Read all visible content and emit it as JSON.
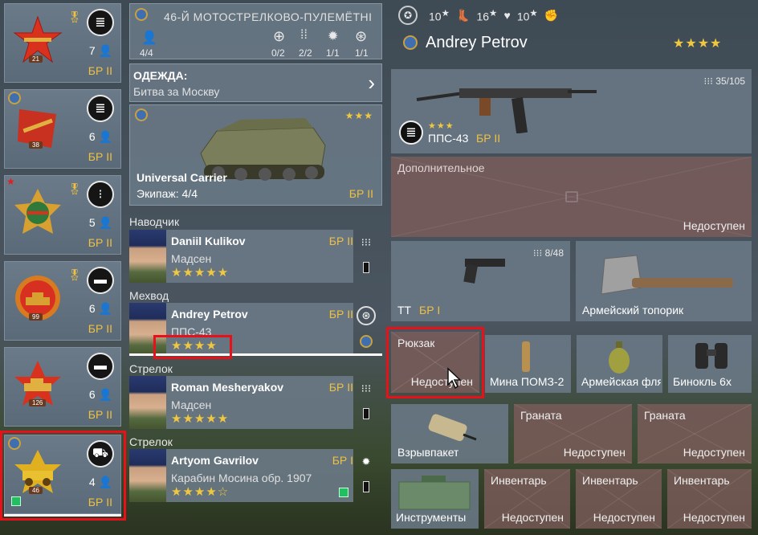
{
  "squads": [
    {
      "count": "7",
      "br": "БР II",
      "lvl": "21",
      "type_icon": "document-icon",
      "emblem": "rifle-star-emblem",
      "medal": "gold"
    },
    {
      "count": "6",
      "br": "БР II",
      "lvl": "38",
      "type_icon": "document-icon",
      "emblem": "rifle-emblem",
      "medal": "blue"
    },
    {
      "count": "5",
      "br": "БР II",
      "lvl": "",
      "type_icon": "ammo-icon",
      "emblem": "engineer-emblem",
      "medal": "gold"
    },
    {
      "count": "6",
      "br": "БР II",
      "lvl": "99",
      "type_icon": "tank-icon",
      "emblem": "tank-emblem",
      "medal": "gold"
    },
    {
      "count": "6",
      "br": "БР II",
      "lvl": "126",
      "type_icon": "tank-icon",
      "emblem": "tank-star-emblem",
      "medal": ""
    },
    {
      "count": "4",
      "br": "БР II",
      "lvl": "46",
      "type_icon": "car-icon",
      "emblem": "vehicle-emblem",
      "medal": "blue"
    }
  ],
  "squad_header": {
    "title": "46-Й МОТОСТРЕЛКОВО-ПУЛЕМЁТНІ",
    "soldiers": "4/4",
    "slots": [
      "0/2",
      "2/2",
      "1/1",
      "1/1"
    ]
  },
  "outfit": {
    "label": "ОДЕЖДА:",
    "value": "Битва за Москву"
  },
  "vehicle": {
    "name": "Universal Carrier",
    "crew": "Экипаж: 4/4",
    "br": "БР II",
    "stars": "★★★"
  },
  "roles": [
    "Наводчик",
    "Мехвод",
    "Стрелок",
    "Стрелок"
  ],
  "soldiers": [
    {
      "name": "Daniil Kulikov",
      "weapon": "Мадсен",
      "stars": "★★★★★",
      "br": "БР II"
    },
    {
      "name": "Andrey Petrov",
      "weapon": "ППС-43",
      "stars": "★★★★",
      "br": "БР II"
    },
    {
      "name": "Roman Mesheryakov",
      "weapon": "Мадсен",
      "stars": "★★★★★",
      "br": "БР II"
    },
    {
      "name": "Artyom Gavrilov",
      "weapon": "Карабин Мосина обр. 1907",
      "stars": "★★★★☆",
      "br": "БР I"
    }
  ],
  "stats": [
    {
      "value": "10",
      "star": "★"
    },
    {
      "value": "16",
      "star": "★"
    },
    {
      "value": "10",
      "star": "★"
    }
  ],
  "selected_soldier": {
    "name": "Andrey Petrov",
    "stars": "★★★★"
  },
  "primary_weapon": {
    "name": "ППС-43",
    "br": "БР II",
    "ammo": "35/105",
    "stars": "★★★"
  },
  "secondary": {
    "label": "Дополнительное",
    "status": "Недоступен"
  },
  "pistol": {
    "name": "ТТ",
    "br": "БР I",
    "ammo": "8/48"
  },
  "melee": {
    "name": "Армейский топорик"
  },
  "backpack": {
    "label": "Рюкзак",
    "status": "Недоступен"
  },
  "items": [
    "Мина ПОМЗ-2",
    "Армейская фляга",
    "Бинокль 6х"
  ],
  "grenades": [
    {
      "name": "Взрывпакет"
    },
    {
      "label": "Граната",
      "status": "Недоступен"
    },
    {
      "label": "Граната",
      "status": "Недоступен"
    }
  ],
  "inventory": [
    {
      "name": "Инструменты"
    },
    {
      "label": "Инвентарь",
      "status": "Недоступен"
    },
    {
      "label": "Инвентарь",
      "status": "Недоступен"
    },
    {
      "label": "Инвентарь",
      "status": "Недоступен"
    }
  ],
  "colors": {
    "highlight": "#e8111a",
    "br": "#f0c040"
  }
}
